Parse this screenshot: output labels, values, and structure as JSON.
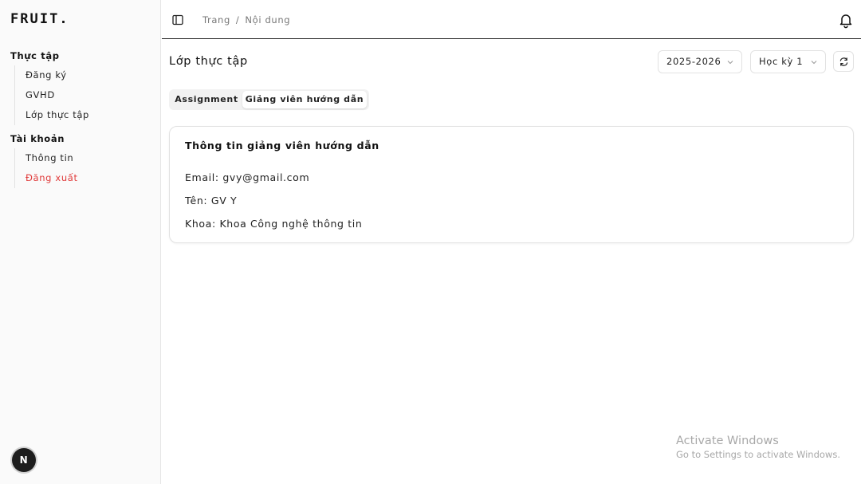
{
  "sidebar": {
    "logo": "FRUIT.",
    "groups": [
      {
        "title": "Thực tập",
        "items": [
          {
            "label": "Đăng ký"
          },
          {
            "label": "GVHD"
          },
          {
            "label": "Lớp thực tập"
          }
        ]
      },
      {
        "title": "Tài khoản",
        "items": [
          {
            "label": "Thông tin"
          },
          {
            "label": "Đăng xuất"
          }
        ]
      }
    ],
    "avatar_letter": "N"
  },
  "header": {
    "breadcrumb": [
      "Trang",
      "Nội dung"
    ],
    "breadcrumb_separator": "/"
  },
  "main": {
    "title": "Lớp thực tập",
    "year_select": "2025-2026",
    "semester_select": "Học kỳ 1",
    "tabs": [
      {
        "label": "Assignment"
      },
      {
        "label": "Giảng viên hướng dẫn"
      }
    ],
    "active_tab": 1,
    "card": {
      "title": "Thông tin giảng viên hướng dẫn",
      "email": "Email: gvy@gmail.com",
      "name": "Tên: GV Y",
      "faculty": "Khoa: Khoa Công nghệ thông tin"
    }
  },
  "watermark": {
    "line1": "Activate Windows",
    "line2": "Go to Settings to activate Windows."
  },
  "colors": {
    "danger": "#e03a3a",
    "border": "#e2e2e2",
    "sidebar_bg": "#fafafa"
  },
  "icons": [
    "panel-left-icon",
    "bell-icon",
    "chevron-down-icon",
    "refresh-icon"
  ]
}
